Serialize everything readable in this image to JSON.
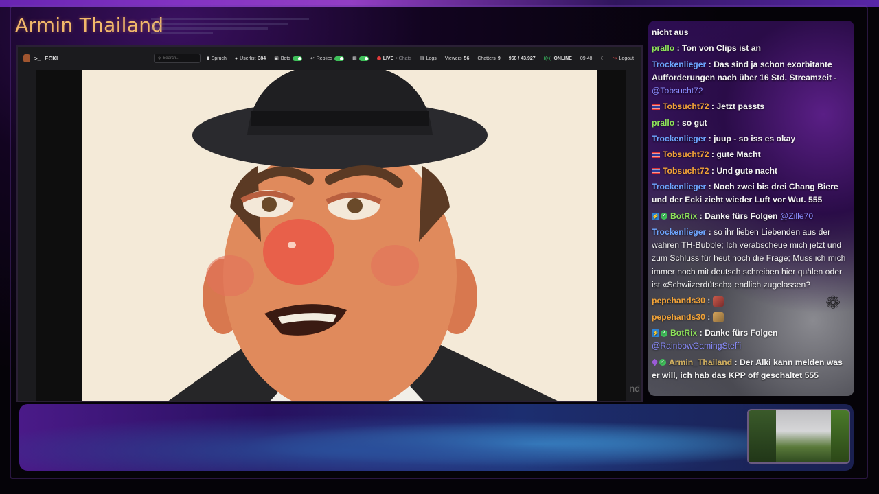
{
  "overlay": {
    "brand_title": "Armin Thailand"
  },
  "toolbar": {
    "channel": "ECKI",
    "search_placeholder": "Search...",
    "spruch": "Spruch",
    "userlist_label": "Userlist",
    "userlist_count": "384",
    "bots": "Bots",
    "replies": "Replies",
    "live": "LIVE",
    "chats": "Chats",
    "logs": "Logs",
    "viewers_label": "Viewers",
    "viewers_count": "56",
    "chatters_label": "Chatters",
    "chatters_count": "9",
    "stats": "968 / 43.927",
    "online": "ONLINE",
    "time": "09:48",
    "logout": "Logout"
  },
  "video": {
    "caption_fragment": "nd"
  },
  "chat": {
    "messages": [
      {
        "text": "nicht aus"
      },
      {
        "user": "prallo",
        "text": "Ton von Clips ist an"
      },
      {
        "user": "Trockenlieger",
        "text": "Das sind ja schon exorbitante Aufforderungen nach über 16 Std. Streamzeit -",
        "mention": "@Tobsucht72"
      },
      {
        "user": "Tobsucht72",
        "text": "Jetzt passts"
      },
      {
        "user": "prallo",
        "text": "so gut"
      },
      {
        "user": "Trockenlieger",
        "text": "juup - so iss es okay"
      },
      {
        "user": "Tobsucht72",
        "text": "gute Macht"
      },
      {
        "user": "Tobsucht72",
        "text": "Und gute nacht"
      },
      {
        "user": "Trockenlieger",
        "text": "Noch zwei bis drei Chang Biere und der Ecki zieht wieder Luft vor Wut. 555"
      },
      {
        "user": "BotRix",
        "text": "Danke fürs Folgen",
        "mention": "@Zille70"
      },
      {
        "user": "Trockenlieger",
        "text": "so ihr lieben Liebenden aus der wahren TH-Bubble; Ich verabscheue mich jetzt und zum Schluss für heut noch die Frage; Muss ich mich immer noch mit deutsch schreiben hier quälen oder ist «Schwiizerdütsch» endlich zugelassen?"
      },
      {
        "user": "pepehands30",
        "text": ""
      },
      {
        "user": "pepehands30",
        "text": ""
      },
      {
        "user": "BotRix",
        "text": "Danke fürs Folgen",
        "mention": "@RainbowGamingSteffi"
      },
      {
        "user": "Armin_Thailand",
        "text": "Der Alki kann melden was er will, ich hab das KPP off geschaltet 555"
      }
    ]
  },
  "colors": {
    "brand": "#f2b86a",
    "live_dot": "#e23b3b",
    "online": "#3fd06a"
  }
}
